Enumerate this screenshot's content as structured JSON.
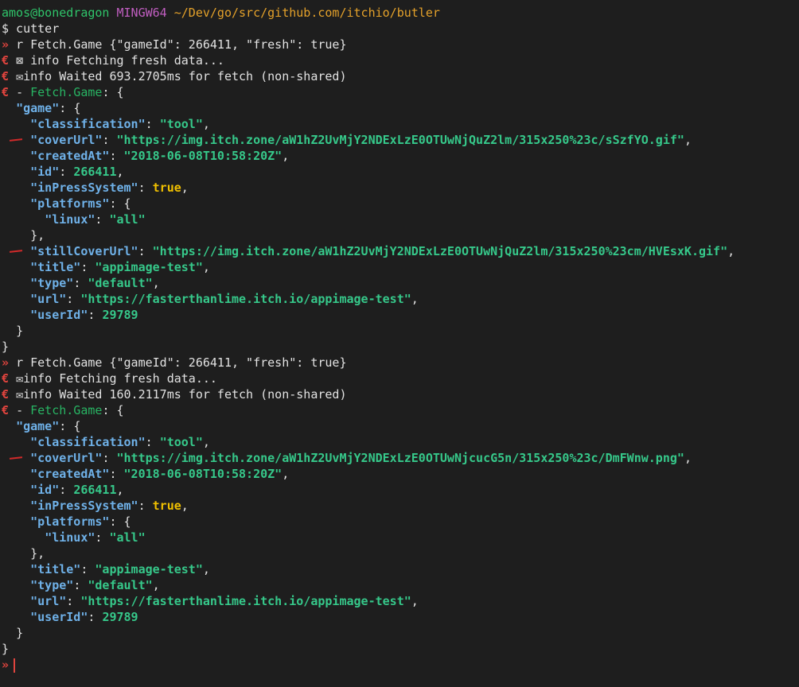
{
  "prompt": {
    "user": "amos@bonedragon",
    "shell": "MINGW64",
    "cwd": "~/Dev/go/src/github.com/itchio/butler"
  },
  "command": "$ cutter",
  "glyphs": {
    "arrow": "»",
    "e": "€",
    "letter_r": "r",
    "env": "✉",
    "small": "⊠",
    "bullet": "-"
  },
  "blocks": [
    {
      "request": "Fetch.Game {\"gameId\": 266411, \"fresh\": true}",
      "info1": "info Fetching fresh data...",
      "info2": "info Waited 693.2705ms for fetch (non-shared)",
      "result_prefix": "Fetch.Game",
      "result_suffix": ": {",
      "game_key": "\"game\"",
      "fields": {
        "classification": {
          "key": "\"classification\"",
          "value": "\"tool\""
        },
        "coverUrl": {
          "key": "\"coverUrl\"",
          "value": "\"https://img.itch.zone/aW1hZ2UvMjY2NDExLzE0OTUwNjQuZ2lm/315x250%23c/sSzfYO.gif\""
        },
        "createdAt": {
          "key": "\"createdAt\"",
          "value": "\"2018-06-08T10:58:20Z\""
        },
        "id": {
          "key": "\"id\"",
          "value": "266411"
        },
        "inPressSystem": {
          "key": "\"inPressSystem\"",
          "value": "true"
        },
        "platforms": {
          "key": "\"platforms\""
        },
        "linux": {
          "key": "\"linux\"",
          "value": "\"all\""
        },
        "stillCoverUrl": {
          "key": "\"stillCoverUrl\"",
          "value": "\"https://img.itch.zone/aW1hZ2UvMjY2NDExLzE0OTUwNjQuZ2lm/315x250%23cm/HVEsxK.gif\""
        },
        "title": {
          "key": "\"title\"",
          "value": "\"appimage-test\""
        },
        "type": {
          "key": "\"type\"",
          "value": "\"default\""
        },
        "url": {
          "key": "\"url\"",
          "value": "\"https://fasterthanlime.itch.io/appimage-test\""
        },
        "userId": {
          "key": "\"userId\"",
          "value": "29789"
        }
      }
    },
    {
      "request": "Fetch.Game {\"gameId\": 266411, \"fresh\": true}",
      "info1": "info Fetching fresh data...",
      "info2": "info Waited 160.2117ms for fetch (non-shared)",
      "result_prefix": "Fetch.Game",
      "result_suffix": ": {",
      "game_key": "\"game\"",
      "fields": {
        "classification": {
          "key": "\"classification\"",
          "value": "\"tool\""
        },
        "coverUrl": {
          "key": "\"coverUrl\"",
          "value": "\"https://img.itch.zone/aW1hZ2UvMjY2NDExLzE0OTUwNjcucG5n/315x250%23c/DmFWnw.png\""
        },
        "createdAt": {
          "key": "\"createdAt\"",
          "value": "\"2018-06-08T10:58:20Z\""
        },
        "id": {
          "key": "\"id\"",
          "value": "266411"
        },
        "inPressSystem": {
          "key": "\"inPressSystem\"",
          "value": "true"
        },
        "platforms": {
          "key": "\"platforms\""
        },
        "linux": {
          "key": "\"linux\"",
          "value": "\"all\""
        },
        "title": {
          "key": "\"title\"",
          "value": "\"appimage-test\""
        },
        "type": {
          "key": "\"type\"",
          "value": "\"default\""
        },
        "url": {
          "key": "\"url\"",
          "value": "\"https://fasterthanlime.itch.io/appimage-test\""
        },
        "userId": {
          "key": "\"userId\"",
          "value": "29789"
        }
      }
    }
  ],
  "punct": {
    "open_brace": "{",
    "close_brace": "}",
    "close_brace_comma": "},",
    "colon_space": ": ",
    "comma": ","
  }
}
